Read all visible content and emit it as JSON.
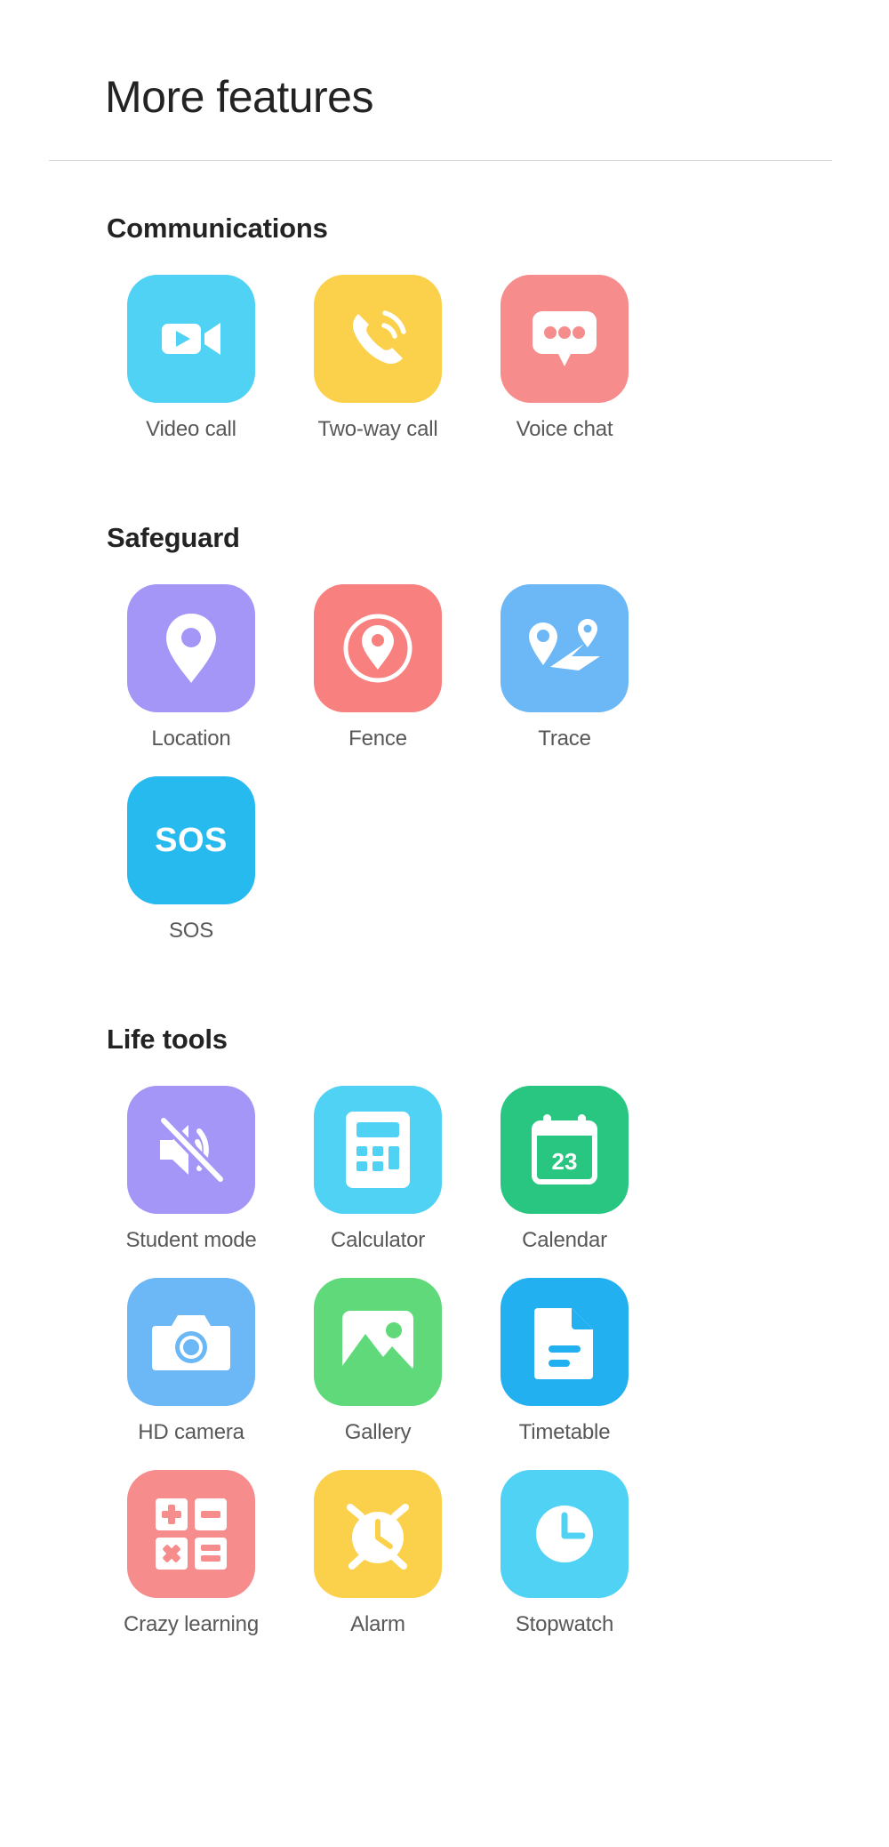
{
  "header": {
    "title": "More features"
  },
  "sections": [
    {
      "id": "communications",
      "title": "Communications",
      "apps": [
        {
          "label": "Video call",
          "icon": "video-camera-icon",
          "color": "#4FD2F3"
        },
        {
          "label": "Two-way call",
          "icon": "phone-call-icon",
          "color": "#FBD04A"
        },
        {
          "label": "Voice chat",
          "icon": "chat-bubble-icon",
          "color": "#F68C8C"
        }
      ]
    },
    {
      "id": "safeguard",
      "title": "Safeguard",
      "apps": [
        {
          "label": "Location",
          "icon": "map-pin-icon",
          "color": "#A396F7"
        },
        {
          "label": "Fence",
          "icon": "pin-in-circle-icon",
          "color": "#F8807F"
        },
        {
          "label": "Trace",
          "icon": "route-path-icon",
          "color": "#6CB7F5"
        },
        {
          "label": "SOS",
          "icon": "sos-text-icon",
          "color": "#27BAEF",
          "text": "SOS"
        }
      ]
    },
    {
      "id": "life-tools",
      "title": "Life tools",
      "apps": [
        {
          "label": "Student mode",
          "icon": "speaker-mute-icon",
          "color": "#A396F7"
        },
        {
          "label": "Calculator",
          "icon": "calculator-icon",
          "color": "#4FD2F3"
        },
        {
          "label": "Calendar",
          "icon": "calendar-icon",
          "color": "#28C680",
          "day": "23"
        },
        {
          "label": "HD camera",
          "icon": "camera-icon",
          "color": "#6CB7F5"
        },
        {
          "label": "Gallery",
          "icon": "image-picture-icon",
          "color": "#5FD97A"
        },
        {
          "label": "Timetable",
          "icon": "document-icon",
          "color": "#22B0F0"
        },
        {
          "label": "Crazy learning",
          "icon": "math-operators-icon",
          "color": "#F68C8C"
        },
        {
          "label": "Alarm",
          "icon": "alarm-clock-icon",
          "color": "#FBD04A"
        },
        {
          "label": "Stopwatch",
          "icon": "clock-icon",
          "color": "#4FD2F3"
        }
      ]
    }
  ]
}
